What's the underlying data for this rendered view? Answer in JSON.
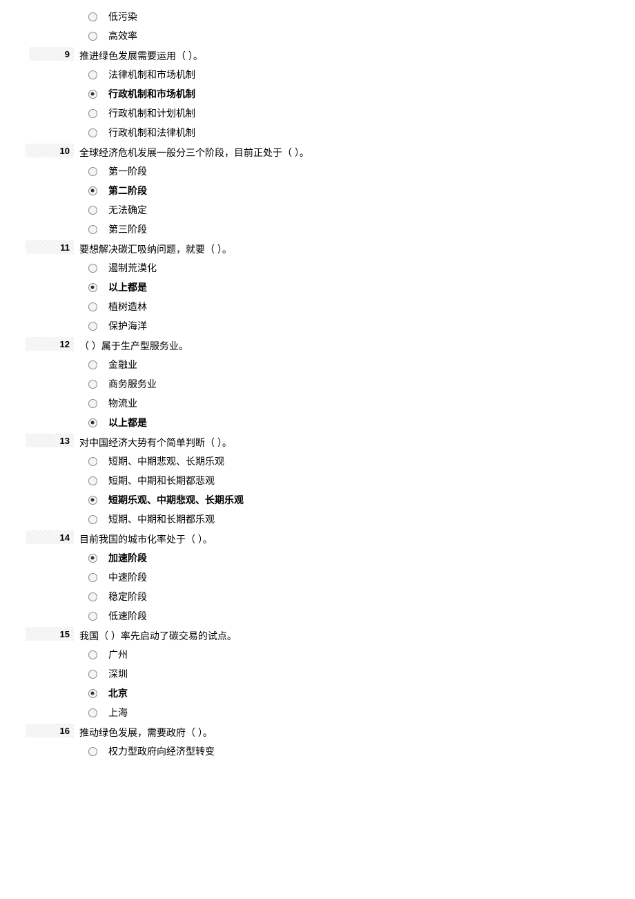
{
  "questions": [
    {
      "number": "",
      "text": "",
      "options": [
        {
          "label": "低污染",
          "selected": false
        },
        {
          "label": "高效率",
          "selected": false
        }
      ]
    },
    {
      "number": "9",
      "text": "推进绿色发展需要运用（ ）。",
      "options": [
        {
          "label": "法律机制和市场机制",
          "selected": false
        },
        {
          "label": "行政机制和市场机制",
          "selected": true
        },
        {
          "label": "行政机制和计划机制",
          "selected": false
        },
        {
          "label": "行政机制和法律机制",
          "selected": false
        }
      ]
    },
    {
      "number": "10",
      "text": "全球经济危机发展一般分三个阶段，目前正处于（ ）。",
      "options": [
        {
          "label": "第一阶段",
          "selected": false
        },
        {
          "label": "第二阶段",
          "selected": true
        },
        {
          "label": "无法确定",
          "selected": false
        },
        {
          "label": "第三阶段",
          "selected": false
        }
      ]
    },
    {
      "number": "11",
      "text": "要想解决碳汇吸纳问题，就要（ ）。",
      "options": [
        {
          "label": "遏制荒漠化",
          "selected": false
        },
        {
          "label": "以上都是",
          "selected": true
        },
        {
          "label": "植树造林",
          "selected": false
        },
        {
          "label": "保护海洋",
          "selected": false
        }
      ]
    },
    {
      "number": "12",
      "text": "（ ）属于生产型服务业。",
      "options": [
        {
          "label": "金融业",
          "selected": false
        },
        {
          "label": "商务服务业",
          "selected": false
        },
        {
          "label": "物流业",
          "selected": false
        },
        {
          "label": "以上都是",
          "selected": true
        }
      ]
    },
    {
      "number": "13",
      "text": "对中国经济大势有个简单判断（ ）。",
      "options": [
        {
          "label": "短期、中期悲观、长期乐观",
          "selected": false
        },
        {
          "label": "短期、中期和长期都悲观",
          "selected": false
        },
        {
          "label": "短期乐观、中期悲观、长期乐观",
          "selected": true
        },
        {
          "label": "短期、中期和长期都乐观",
          "selected": false
        }
      ]
    },
    {
      "number": "14",
      "text": "目前我国的城市化率处于（ ）。",
      "options": [
        {
          "label": "加速阶段",
          "selected": true
        },
        {
          "label": "中速阶段",
          "selected": false
        },
        {
          "label": "稳定阶段",
          "selected": false
        },
        {
          "label": "低速阶段",
          "selected": false
        }
      ]
    },
    {
      "number": "15",
      "text": "我国（ ）率先启动了碳交易的试点。",
      "options": [
        {
          "label": "广州",
          "selected": false
        },
        {
          "label": "深圳",
          "selected": false
        },
        {
          "label": "北京",
          "selected": true
        },
        {
          "label": "上海",
          "selected": false
        }
      ]
    },
    {
      "number": "16",
      "text": "推动绿色发展，需要政府（ ）。",
      "options": [
        {
          "label": "权力型政府向经济型转变",
          "selected": false
        }
      ]
    }
  ]
}
